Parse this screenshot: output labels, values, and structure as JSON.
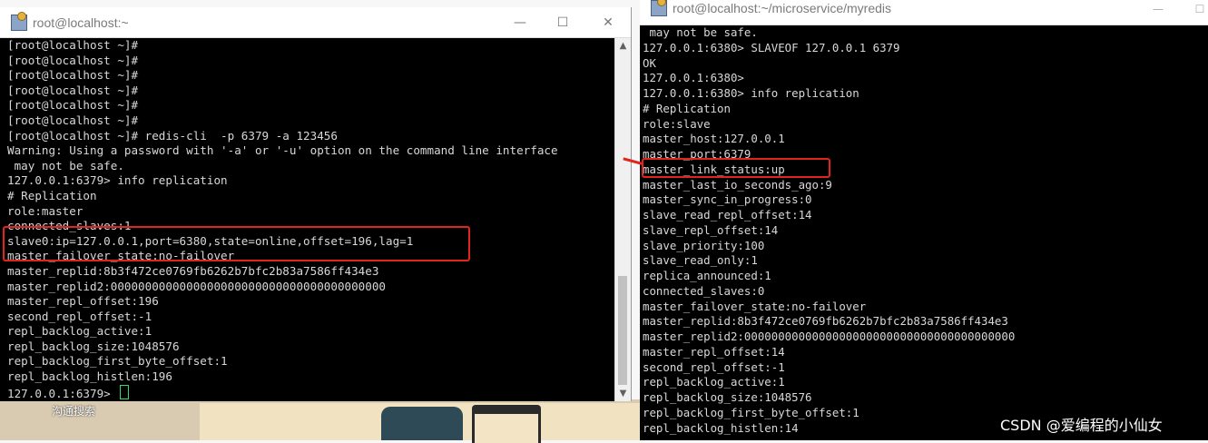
{
  "background": {
    "caption": "沟通搜索"
  },
  "left_window": {
    "title": "root@localhost:~",
    "controls": {
      "minimize": "—",
      "maximize": "☐",
      "close": "✕"
    },
    "lines": [
      "[root@localhost ~]#",
      "[root@localhost ~]#",
      "[root@localhost ~]#",
      "[root@localhost ~]#",
      "[root@localhost ~]#",
      "[root@localhost ~]#",
      "[root@localhost ~]# redis-cli  -p 6379 -a 123456",
      "Warning: Using a password with '-a' or '-u' option on the command line interface",
      " may not be safe.",
      "127.0.0.1:6379> info replication",
      "# Replication",
      "role:master",
      "connected_slaves:1",
      "slave0:ip=127.0.0.1,port=6380,state=online,offset=196,lag=1",
      "master_failover_state:no-failover",
      "master_replid:8b3f472ce0769fb6262b7bfc2b83a7586ff434e3",
      "master_replid2:0000000000000000000000000000000000000000",
      "master_repl_offset:196",
      "second_repl_offset:-1",
      "repl_backlog_active:1",
      "repl_backlog_size:1048576",
      "repl_backlog_first_byte_offset:1",
      "repl_backlog_histlen:196"
    ],
    "prompt": "127.0.0.1:6379> "
  },
  "right_window": {
    "title": "root@localhost:~/microservice/myredis",
    "controls": {
      "minimize": "—",
      "maximize": "☐"
    },
    "lines": [
      " may not be safe.",
      "127.0.0.1:6380> SLAVEOF 127.0.0.1 6379",
      "OK",
      "127.0.0.1:6380>",
      "127.0.0.1:6380> info replication",
      "# Replication",
      "role:slave",
      "master_host:127.0.0.1",
      "master_port:6379",
      "master_link_status:up",
      "master_last_io_seconds_ago:9",
      "master_sync_in_progress:0",
      "slave_read_repl_offset:14",
      "slave_repl_offset:14",
      "slave_priority:100",
      "slave_read_only:1",
      "replica_announced:1",
      "connected_slaves:0",
      "master_failover_state:no-failover",
      "master_replid:8b3f472ce0769fb6262b7bfc2b83a7586ff434e3",
      "master_replid2:0000000000000000000000000000000000000000",
      "master_repl_offset:14",
      "second_repl_offset:-1",
      "repl_backlog_active:1",
      "repl_backlog_size:1048576",
      "repl_backlog_first_byte_offset:1",
      "repl_backlog_histlen:14"
    ]
  },
  "watermark": "CSDN @爱编程的小仙女",
  "colors": {
    "terminal_bg": "#000000",
    "terminal_fg": "#d8d8d8",
    "highlight": "#e0261c",
    "cursor": "#3dd66b"
  }
}
